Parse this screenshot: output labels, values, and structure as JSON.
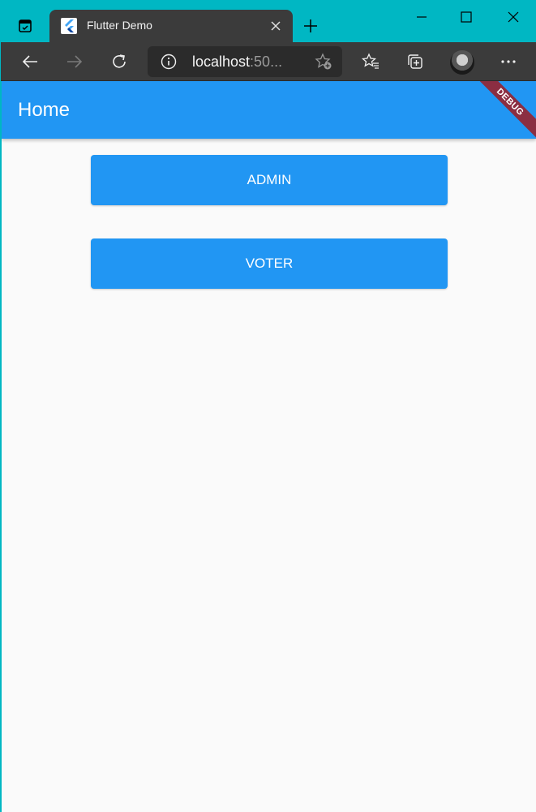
{
  "browser": {
    "tab_title": "Flutter Demo",
    "url_host": "localhost",
    "url_port": ":50...",
    "colors": {
      "frame": "#00b7c3",
      "toolbar": "#3b3b3b"
    }
  },
  "app": {
    "appbar_title": "Home",
    "debug_banner": "DEBUG",
    "buttons": {
      "admin": "ADMIN",
      "voter": "VOTER"
    },
    "colors": {
      "primary": "#2196f3",
      "background": "#fafafa",
      "banner": "#8b2e42"
    }
  }
}
